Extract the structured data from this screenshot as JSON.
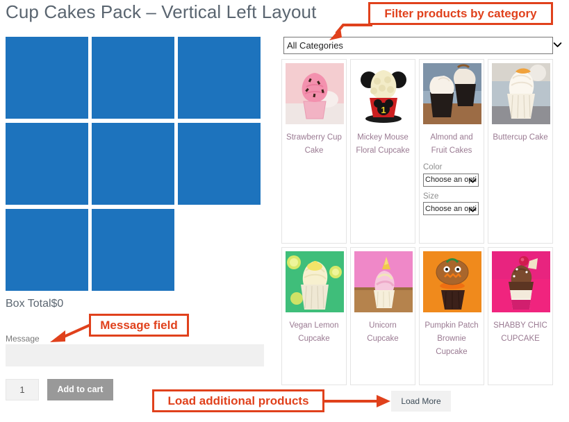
{
  "page": {
    "title": "Cup Cakes Pack – Vertical Left Layout"
  },
  "builder": {
    "box_slot_count": 8,
    "box_slot_color": "#1d73bd",
    "box_total_label": "Box Total$0",
    "message_label": "Message",
    "message_value": "",
    "message_placeholder": "",
    "quantity_value": "1",
    "add_to_cart_label": "Add to cart"
  },
  "filter": {
    "selected": "All Categories",
    "options": [
      "All Categories"
    ]
  },
  "products": {
    "rows": [
      {
        "items": [
          {
            "name": "Strawberry Cup Cake",
            "thumb": "strawberry-cupcake-image",
            "attributes": []
          },
          {
            "name": "Mickey Mouse Floral Cupcake",
            "thumb": "mickey-mouse-cupcake-image",
            "attributes": []
          },
          {
            "name": "Almond and Fruit Cakes",
            "thumb": "almond-fruit-cupcake-image",
            "attributes": [
              {
                "label": "Color",
                "value": "Choose an option"
              },
              {
                "label": "Size",
                "value": "Choose an option"
              }
            ]
          },
          {
            "name": "Buttercup Cake",
            "thumb": "buttercup-cake-image",
            "attributes": []
          }
        ]
      },
      {
        "items": [
          {
            "name": "Vegan Lemon Cupcake",
            "thumb": "vegan-lemon-cupcake-image",
            "attributes": []
          },
          {
            "name": "Unicorn Cupcake",
            "thumb": "unicorn-cupcake-image",
            "attributes": []
          },
          {
            "name": "Pumpkin Patch Brownie Cupcake",
            "thumb": "pumpkin-patch-cupcake-image",
            "attributes": []
          },
          {
            "name": "SHABBY CHIC CUPCAKE",
            "thumb": "shabby-chic-cupcake-image",
            "attributes": []
          }
        ]
      }
    ],
    "load_more_label": "Load More"
  },
  "annotations": {
    "filter": "Filter products by category",
    "message": "Message field",
    "load_more": "Load additional products",
    "color": "#e0411c"
  }
}
